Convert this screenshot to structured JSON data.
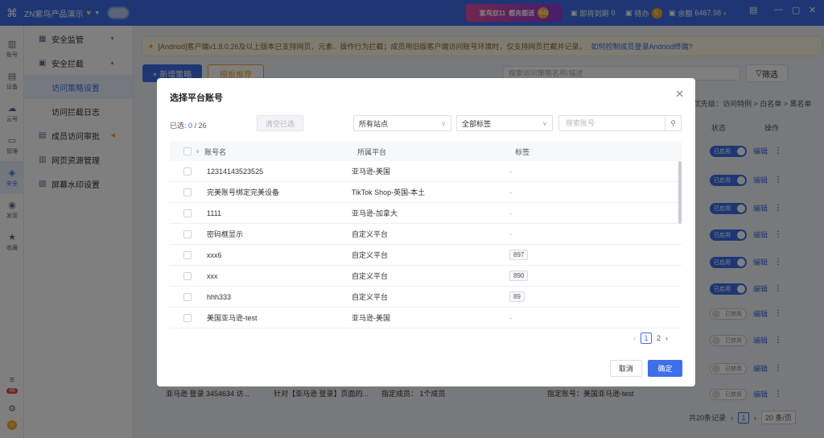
{
  "topbar": {
    "app_title": "ZN紫鸟产品演示",
    "banner_main": "紫鸟双11",
    "banner_sub": "都充都送",
    "banner_go": "GO",
    "expiring_label": "即将到期",
    "expiring_count": "0",
    "todo_label": "待办",
    "todo_count": "5",
    "balance_label": "余额",
    "balance_value": "6467.98"
  },
  "rail": {
    "items": [
      {
        "label": "账号",
        "icon": "user-icon"
      },
      {
        "label": "设备",
        "icon": "device-icon"
      },
      {
        "label": "云号",
        "icon": "cloud-icon"
      },
      {
        "label": "管理",
        "icon": "manage-icon"
      },
      {
        "label": "安全",
        "icon": "shield-icon"
      },
      {
        "label": "发现",
        "icon": "discover-icon"
      },
      {
        "label": "收藏",
        "icon": "star-icon"
      }
    ],
    "notif_count": "46"
  },
  "submenu": {
    "monitor": "安全监管",
    "intercept": "安全拦截",
    "policy": "访问策略设置",
    "log": "访问拦截日志",
    "approval": "成员访问审批",
    "resource": "网页资源管理",
    "watermark": "屏幕水印设置"
  },
  "notice": {
    "text": "[Andriod]客户端v1.8.0.26及以上版本已支持网页、元素、操作行为拦截；成员用旧版客户端访问账号环境时，仅支持网页拦截并记录。",
    "link": "如何控制成员登录Andriod终端?"
  },
  "background": {
    "new_policy": "+ 新增策略",
    "template": "模板推荐",
    "search_placeholder": "搜索访问策略名称/描述",
    "filter": "筛选",
    "priority": "优先级：访问特例 > 白名单 > 黑名单",
    "col_status": "状态",
    "col_action": "操作",
    "enabled": "已启用",
    "disabled": "已禁用",
    "edit": "编辑",
    "last_row": {
      "name": "亚马逊 登录 3454634 访...",
      "desc": "针对【亚马逊 登录】页面的...",
      "members": "指定成员：  1个成员",
      "accounts": "指定账号：美国亚马逊-test"
    },
    "pager_total": "共20条记录",
    "pager_page": "1",
    "pager_size": "20 条/页"
  },
  "modal": {
    "title": "选择平台账号",
    "selected_label": "已选:",
    "selected_count": "0",
    "selected_total": "/ 26",
    "clear_btn": "清空已选",
    "site_select": "所有站点",
    "tag_select": "全部标签",
    "search_placeholder": "搜索账号",
    "columns": {
      "name": "账号名",
      "platform": "所属平台",
      "tag": "标签"
    },
    "rows": [
      {
        "name": "12314143523525",
        "platform": "亚马逊-美国",
        "tag": "-"
      },
      {
        "name": "完美账号绑定完美设备",
        "platform": "TikTok Shop-英国-本土",
        "tag": "-"
      },
      {
        "name": "1111",
        "platform": "亚马逊-加拿大",
        "tag": "-"
      },
      {
        "name": "密码框显示",
        "platform": "自定义平台",
        "tag": "-"
      },
      {
        "name": "xxx6",
        "platform": "自定义平台",
        "tag": "897"
      },
      {
        "name": "xxx",
        "platform": "自定义平台",
        "tag": "890"
      },
      {
        "name": "hhh333",
        "platform": "自定义平台",
        "tag": "89"
      },
      {
        "name": "美国亚马逊-test",
        "platform": "亚马逊-美国",
        "tag": "-"
      }
    ],
    "pager": {
      "prev": "‹",
      "current": "1",
      "next_page": "2",
      "next": "›"
    },
    "cancel": "取消",
    "confirm": "确定"
  }
}
